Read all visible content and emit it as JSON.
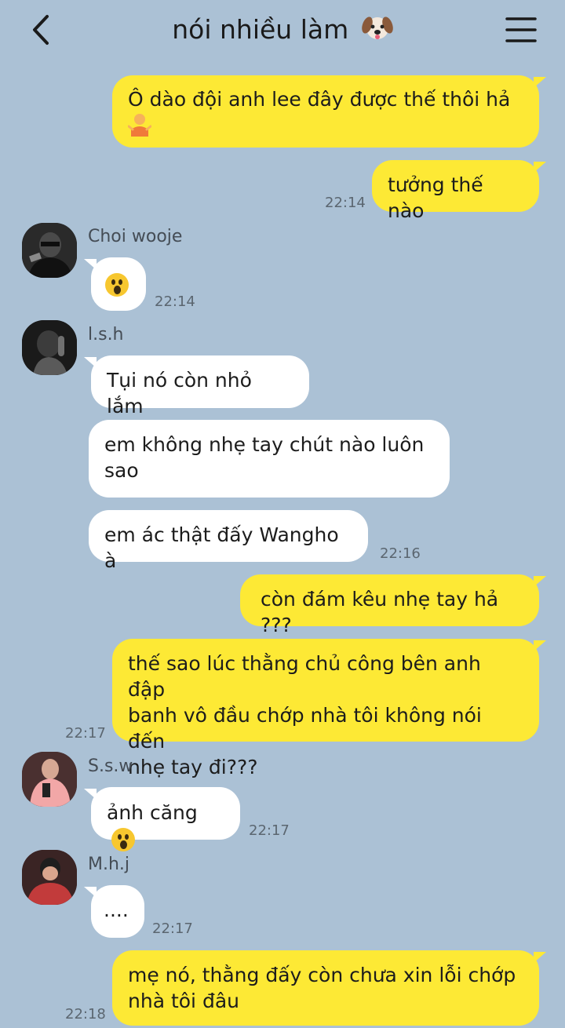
{
  "header": {
    "title": "nói nhiều làm"
  },
  "messages": {
    "m1": {
      "text": "Ô dào đội anh lee đây được thế thôi hả",
      "emoji": "person-shrugging"
    },
    "m2": {
      "text": "tưởng thế nào",
      "time": "22:14"
    },
    "m3": {
      "sender": "Choi wooje",
      "emoji": "face-open-mouth",
      "time": "22:14"
    },
    "m4": {
      "sender": "l.s.h",
      "text": "Tụi nó còn nhỏ lắm"
    },
    "m5": {
      "text_line1": "em không nhẹ tay chút nào luôn",
      "text_line2": "sao"
    },
    "m6": {
      "text": "em ác thật đấy Wangho à",
      "time": "22:16"
    },
    "m7": {
      "text": "còn đám kêu nhẹ tay hả ???"
    },
    "m8": {
      "line1": "thế sao lúc thằng chủ công bên anh đập",
      "line2": "banh vô đầu chớp nhà tôi không nói đến",
      "line3": "nhẹ tay đi???",
      "time": "22:17"
    },
    "m9": {
      "sender": "S.s.w",
      "text": "ảnh căng",
      "emoji": "face-open-mouth",
      "time": "22:17"
    },
    "m10": {
      "sender": "M.h.j",
      "text": "....",
      "time": "22:17"
    },
    "m11": {
      "line1": "mẹ nó, thằng đấy còn chưa xin lỗi chớp",
      "line2": "nhà tôi đâu",
      "time": "22:18"
    }
  },
  "icons": {
    "back": "chevron-left-icon",
    "menu": "hamburger-menu-icon",
    "title_emoji": "dog-face-icon"
  },
  "colors": {
    "background": "#abc1d5",
    "my_bubble": "#fde935",
    "other_bubble": "#ffffff"
  }
}
